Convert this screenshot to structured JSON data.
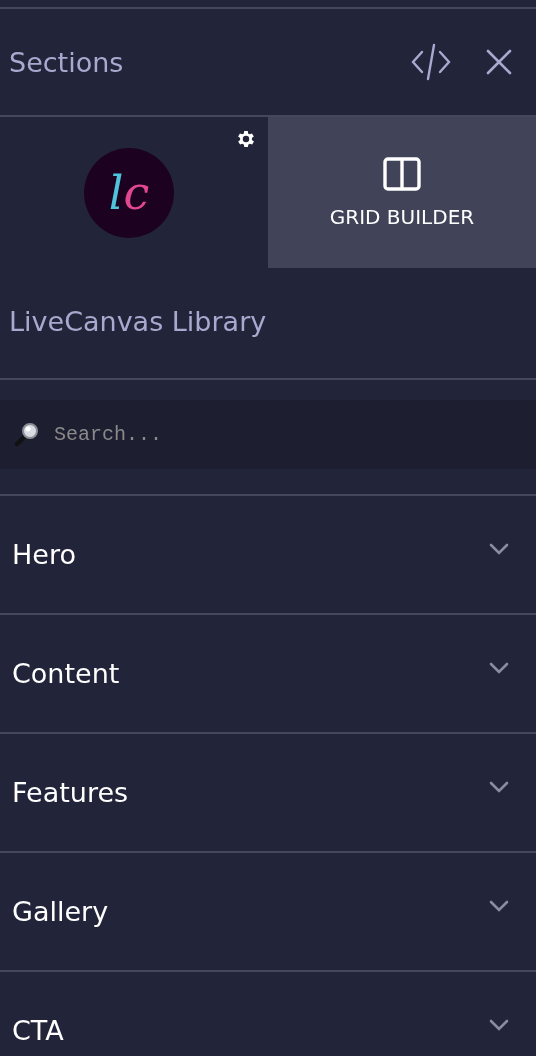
{
  "header": {
    "title": "Sections"
  },
  "tiles": [
    {
      "kind": "logo",
      "selected": false,
      "logo": [
        {
          "text": "l",
          "color": "#4fc3d9"
        },
        {
          "text": "c",
          "color": "#e2488f"
        }
      ]
    },
    {
      "kind": "grid",
      "selected": true,
      "label": "GRID BUILDER"
    }
  ],
  "library_title": "LiveCanvas Library",
  "search": {
    "placeholder": "Search..."
  },
  "sections": [
    {
      "label": "Hero",
      "expanded": false
    },
    {
      "label": "Content",
      "expanded": false
    },
    {
      "label": "Features",
      "expanded": false
    },
    {
      "label": "Gallery",
      "expanded": false
    },
    {
      "label": "CTA",
      "expanded": false
    }
  ]
}
